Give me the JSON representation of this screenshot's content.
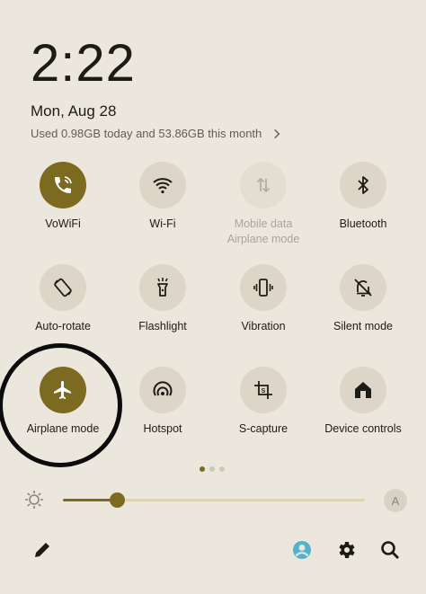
{
  "header": {
    "time": "2:22",
    "date": "Mon, Aug 28",
    "usage": "Used 0.98GB today and 53.86GB this month"
  },
  "tiles": [
    {
      "label": "VoWiFi",
      "icon": "wifi-call-icon",
      "state": "on"
    },
    {
      "label": "Wi-Fi",
      "icon": "wifi-icon",
      "state": "normal"
    },
    {
      "label": "Mobile data",
      "sublabel": "Airplane mode",
      "icon": "mobile-data-icon",
      "state": "disabled"
    },
    {
      "label": "Bluetooth",
      "icon": "bluetooth-icon",
      "state": "normal"
    },
    {
      "label": "Auto-rotate",
      "icon": "auto-rotate-icon",
      "state": "normal"
    },
    {
      "label": "Flashlight",
      "icon": "flashlight-icon",
      "state": "normal"
    },
    {
      "label": "Vibration",
      "icon": "vibration-icon",
      "state": "normal"
    },
    {
      "label": "Silent mode",
      "icon": "silent-mode-icon",
      "state": "normal"
    },
    {
      "label": "Airplane mode",
      "icon": "airplane-icon",
      "state": "on"
    },
    {
      "label": "Hotspot",
      "icon": "hotspot-icon",
      "state": "normal"
    },
    {
      "label": "S-capture",
      "icon": "s-capture-icon",
      "state": "normal"
    },
    {
      "label": "Device controls",
      "icon": "device-controls-icon",
      "state": "normal"
    }
  ],
  "page_indicator": {
    "count": 3,
    "active": 0
  },
  "brightness": {
    "level": 0.18,
    "auto_label": "A"
  },
  "colors": {
    "accent": "#7d6a21",
    "background": "#ece7dc",
    "tile": "#ddd6c8",
    "annotation": "#0c0c0c"
  },
  "bottom_bar": [
    "edit-icon",
    "user-icon",
    "settings-icon",
    "search-icon"
  ]
}
